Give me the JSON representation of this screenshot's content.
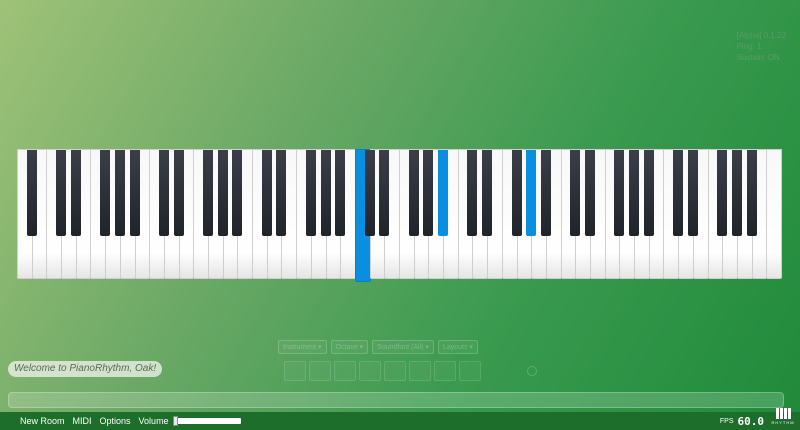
{
  "status": {
    "version": "[Alpha] 0.1.22",
    "ping": "Ping: 1",
    "sustain": "Sustain: ON"
  },
  "piano": {
    "white_key_count": 52,
    "active_white_keys": [
      23
    ],
    "black_key_pattern": [
      1,
      1,
      0,
      1,
      1,
      1,
      0
    ],
    "active_black_keys": [
      20,
      24
    ],
    "active_color": "#0a8fe0"
  },
  "chat": {
    "welcome_message": "Welcome to PianoRhythm, Oak!"
  },
  "bottom_bar": {
    "new_room": "New Room",
    "midi": "MIDI",
    "options": "Options",
    "volume": "Volume",
    "fps_label": "FPS",
    "fps_value": "60.0",
    "logo_text": "RHYTHM"
  },
  "ghost_toolbar": {
    "selects": [
      "Instrument ▾",
      "Octave ▾",
      "Soundfont (All) ▾",
      "Layouts ▾"
    ]
  },
  "colors": {
    "bar_bg": "#1d6e2a",
    "accent": "#0a8fe0"
  }
}
